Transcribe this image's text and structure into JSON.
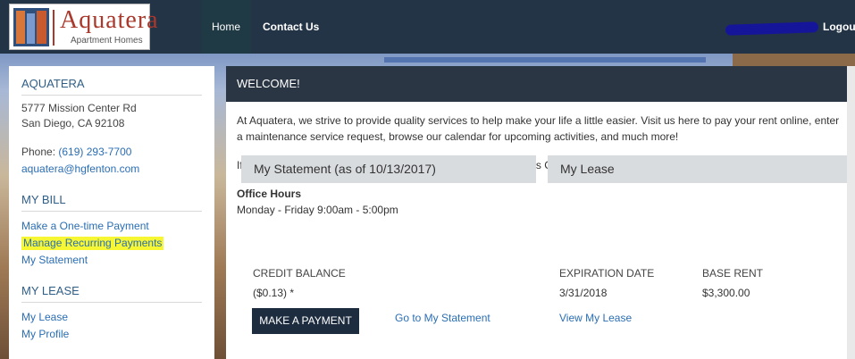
{
  "logo": {
    "name": "Aquatera",
    "subtitle": "Apartment Homes"
  },
  "nav": {
    "home": "Home",
    "contact": "Contact Us",
    "logout": "Logout"
  },
  "sidebar": {
    "property_heading": "AQUATERA",
    "address_line1": "5777 Mission Center Rd",
    "address_line2": "San Diego, CA 92108",
    "phone_label": "Phone:",
    "phone": "(619) 293-7700",
    "email": "aquatera@hgfenton.com",
    "bill_heading": "MY BILL",
    "bill_links": [
      "Make a One-time Payment",
      "Manage Recurring Payments",
      "My Statement"
    ],
    "lease_heading": "MY LEASE",
    "lease_links": [
      "My Lease",
      "My Profile"
    ]
  },
  "main": {
    "welcome": "WELCOME!",
    "intro1": "At Aquatera, we strive to provide quality services to help make your life a little easier. Visit us here to pay your rent online, enter a maintenance service request, browse our calendar for upcoming activities, and much more!",
    "intro2": "If you have any questions, please contact our Resident Services Coordinator at (619) 293-7700.",
    "hours_title": "Office Hours",
    "hours_value": "Monday - Friday 9:00am - 5:00pm"
  },
  "statement": {
    "title": "My Statement (as of 10/13/2017)",
    "balance_label": "CREDIT BALANCE",
    "balance_value": "($0.13) *",
    "pay_button": "MAKE A PAYMENT",
    "statement_link": "Go to My Statement"
  },
  "lease": {
    "title": "My Lease",
    "expiration_label": "EXPIRATION DATE",
    "expiration_value": "3/31/2018",
    "rent_label": "BASE RENT",
    "rent_value": "$3,300.00",
    "view_link": "View My Lease"
  },
  "colors": {
    "nav_bg": "#243447",
    "link": "#2a6eb4",
    "highlight": "#f6f633",
    "heading": "#2f5e87"
  }
}
